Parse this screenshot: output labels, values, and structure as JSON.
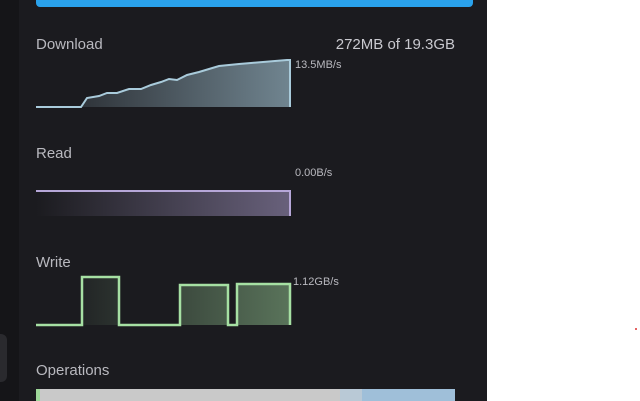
{
  "download": {
    "label": "Download",
    "progress": "272MB of 19.3GB",
    "rate": "13.5MB/s"
  },
  "read": {
    "label": "Read",
    "rate": "0.00B/s"
  },
  "write": {
    "label": "Write",
    "rate": "1.12GB/s"
  },
  "operations": {
    "label": "Operations"
  },
  "colors": {
    "accent_button": "#2aa2ec",
    "download_line": "#a9cbdb",
    "read_line": "#b6a7d8",
    "write_line": "#a6e0a3",
    "panel_bg": "#1b1b1f"
  }
}
